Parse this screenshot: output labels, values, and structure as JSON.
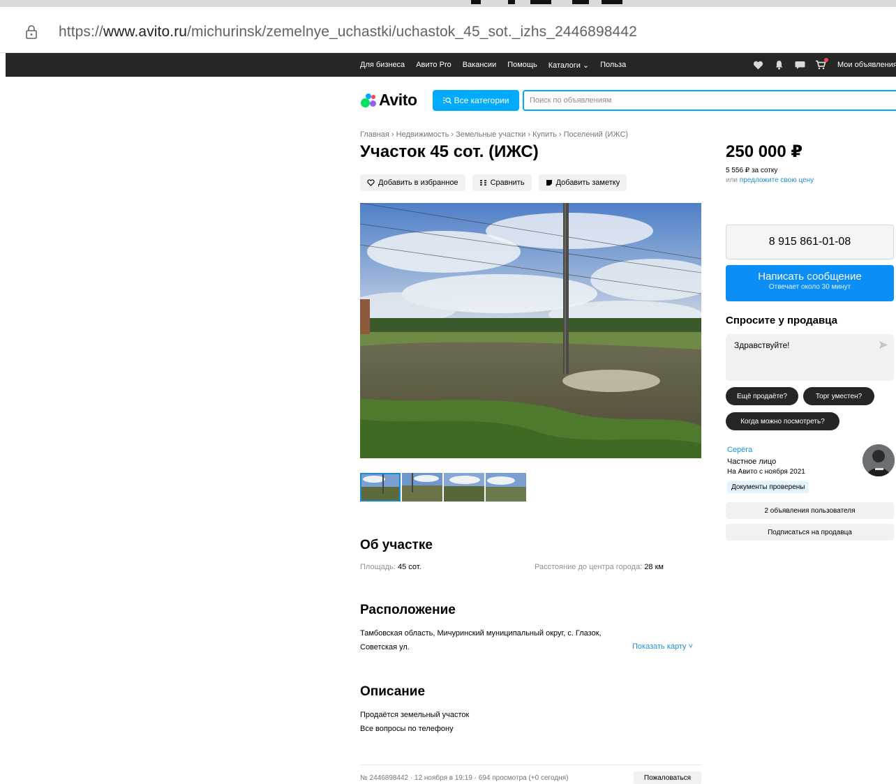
{
  "browser": {
    "url_prefix": "https://",
    "url_host": "www.avito.ru",
    "url_path": "/michurinsk/zemelnye_uchastki/uchastok_45_sot._izhs_2446898442"
  },
  "topnav": {
    "links": [
      "Для бизнеса",
      "Авито Pro",
      "Вакансии",
      "Помощь",
      "Каталоги ⌄",
      "Польза"
    ],
    "my_ads": "Мои объявления"
  },
  "header": {
    "logo_text": "Avito",
    "categories_button": "Все категории",
    "search_placeholder": "Поиск по объявлениям",
    "brand_color": "#00aaff"
  },
  "breadcrumbs": "Главная › Недвижимость › Земельные участки › Купить › Поселений (ИЖС)",
  "listing": {
    "title": "Участок 45 сот. (ИЖС)",
    "actions": {
      "favorite": "Добавить в избранное",
      "compare": "Сравнить",
      "note": "Добавить заметку"
    },
    "thumbnails_count": 4
  },
  "about": {
    "heading": "Об участке",
    "area_label": "Площадь:",
    "area_value": "45 сот.",
    "distance_label": "Расстояние до центра города:",
    "distance_value": "28 км"
  },
  "location": {
    "heading": "Расположение",
    "address": "Тамбовская область, Мичуринский муниципальный округ, с. Глазок, Советская ул.",
    "map_link": "Показать карту ˅"
  },
  "description": {
    "heading": "Описание",
    "line1": "Продаётся земельный участок",
    "line2": "Все вопросы по телефону"
  },
  "footer": {
    "meta": "№ 2446898442 · 12 ноября в 19:19 · 694 просмотра (+0 сегодня)",
    "report": "Пожаловаться"
  },
  "sidebar": {
    "price": "250 000 ₽",
    "price_per_sotka": "5 556 ₽ за сотку",
    "offer_prefix": "или",
    "offer_link": "предложите свою цену",
    "phone": "8 915 861-01-08",
    "message_button": "Написать сообщение",
    "message_sub": "Отвечает около 30 минут",
    "ask_heading": "Спросите у продавца",
    "chat_text": "Здравствуйте!",
    "quick_questions": [
      "Ещё продаёте?",
      "Торг уместен?",
      "Когда можно посмотреть?"
    ],
    "seller_name": "Серёга",
    "seller_type": "Частное лицо",
    "seller_since": "На Авито с ноября 2021",
    "documents_badge": "Документы проверены",
    "user_ads_button": "2 объявления пользователя",
    "subscribe_button": "Подписаться на продавца"
  }
}
